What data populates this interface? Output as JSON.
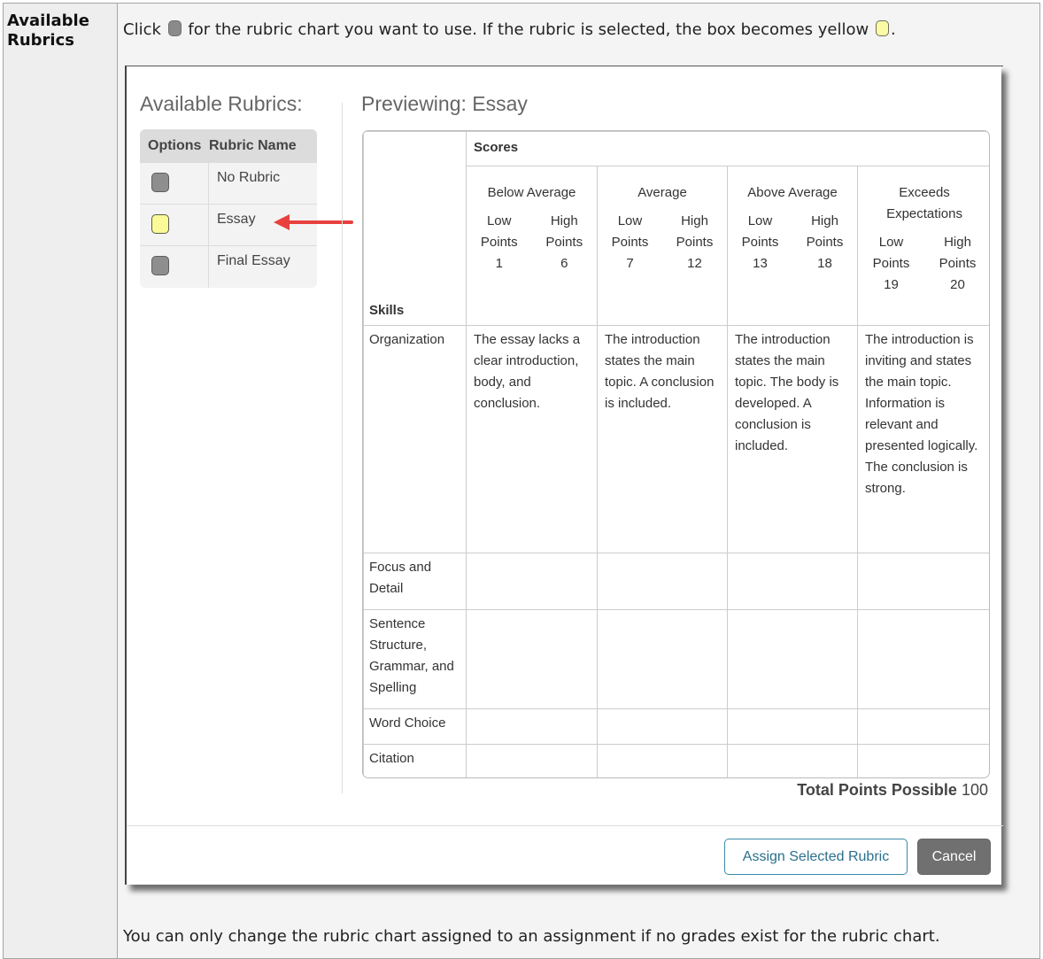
{
  "label": "Available Rubrics",
  "intro": {
    "part1": "Click",
    "part2": "for the rubric chart you want to use. If the rubric is selected, the box becomes yellow",
    "part3": "."
  },
  "modal": {
    "left_title": "Available Rubrics:",
    "list_headers": [
      "Options",
      "Rubric Name"
    ],
    "rubrics": [
      {
        "name": "No Rubric",
        "selected": false
      },
      {
        "name": "Essay",
        "selected": true
      },
      {
        "name": "Final Essay",
        "selected": false
      }
    ],
    "preview_title": "Previewing: Essay",
    "scores_header": "Scores",
    "skills_header": "Skills",
    "levels": [
      {
        "name": "Below Average",
        "low_label": "Low",
        "high_label": "High",
        "points_label": "Points",
        "low": "1",
        "high": "6"
      },
      {
        "name": "Average",
        "low_label": "Low",
        "high_label": "High",
        "points_label": "Points",
        "low": "7",
        "high": "12"
      },
      {
        "name": "Above Average",
        "low_label": "Low",
        "high_label": "High",
        "points_label": "Points",
        "low": "13",
        "high": "18"
      },
      {
        "name": "Exceeds Expectations",
        "low_label": "Low",
        "high_label": "High",
        "points_label": "Points",
        "low": "19",
        "high": "20"
      }
    ],
    "skills": [
      {
        "name": "Organization",
        "cells": [
          "The essay lacks a clear introduction, body, and conclusion.",
          "The introduction states the main topic. A conclusion is included.",
          "The introduction states the main topic. The body is developed. A conclusion is included.",
          "The introduction is inviting and states the main topic. Information is relevant and presented logically. The conclusion is strong."
        ]
      },
      {
        "name": "Focus and Detail",
        "cells": [
          "",
          "",
          "",
          ""
        ]
      },
      {
        "name": "Sentence Structure, Grammar, and Spelling",
        "cells": [
          "",
          "",
          "",
          ""
        ]
      },
      {
        "name": "Word Choice",
        "cells": [
          "",
          "",
          "",
          ""
        ]
      },
      {
        "name": "Citation",
        "cells": [
          "",
          "",
          "",
          ""
        ]
      }
    ],
    "total_label": "Total Points Possible",
    "total_value": "100",
    "assign_button": "Assign Selected Rubric",
    "cancel_button": "Cancel"
  },
  "bottom_text": "You can only change the rubric chart assigned to an assignment if no grades exist for the rubric chart.",
  "colors": {
    "selected": "#fafa99",
    "unselected": "#8e8e8e",
    "arrow": "#e8413d",
    "assign_border": "#3b8aa6"
  }
}
